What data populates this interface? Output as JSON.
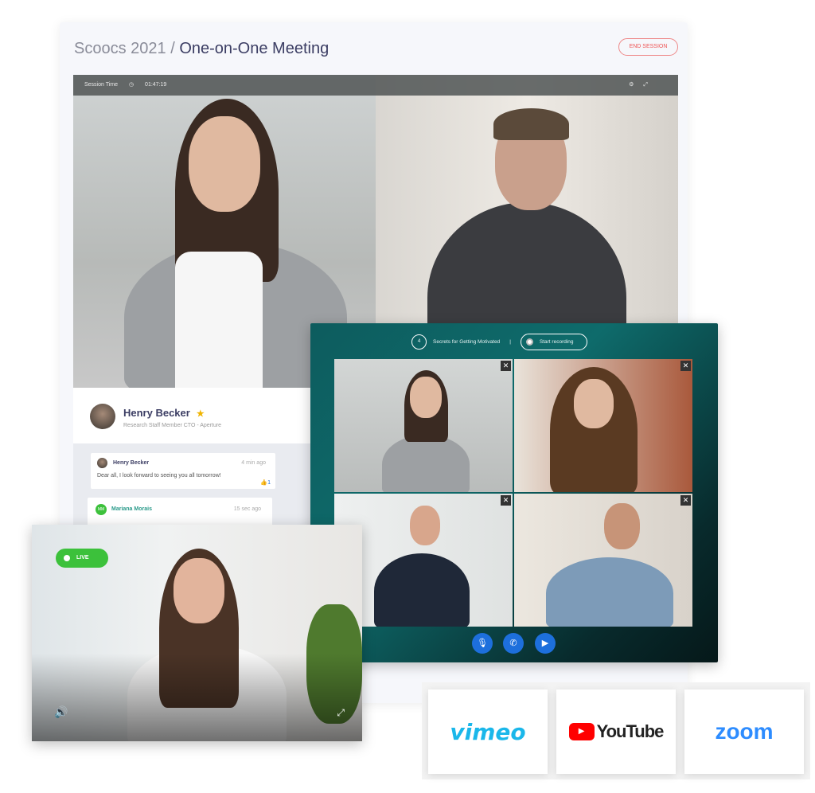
{
  "header": {
    "breadcrumb_root": "Scoocs 2021 / ",
    "title": "One-on-One Meeting",
    "end_session": "END SESSION"
  },
  "video_bar": {
    "session_label": "Session Time",
    "time": "01:47:19",
    "icons": [
      "clock-icon",
      "gear-icon",
      "expand-icon"
    ]
  },
  "profile": {
    "name": "Henry Becker",
    "role": "Research Staff Member CTO - Aperture"
  },
  "chat": [
    {
      "author": "Henry Becker",
      "time": "4 min ago",
      "text": "Dear all, I look forward to seeing you all tomorrow!",
      "likes": "1"
    },
    {
      "author": "Mariana Morais",
      "initials": "MM",
      "time": "15 sec ago"
    }
  ],
  "gallery": {
    "session_number": "4",
    "session_title": "Secrets for Getting Motivated",
    "record_label": "Start recording",
    "controls": [
      "microphone-icon",
      "phone-icon",
      "camera-icon"
    ]
  },
  "live": {
    "badge": "LIVE"
  },
  "platforms": {
    "vimeo": "vimeo",
    "youtube": "YouTube",
    "zoom": "zoom"
  },
  "colors": {
    "accent": "#1d6fdc",
    "live": "#3cc13b",
    "end": "#e55555",
    "teal": "#0e6b6b"
  }
}
